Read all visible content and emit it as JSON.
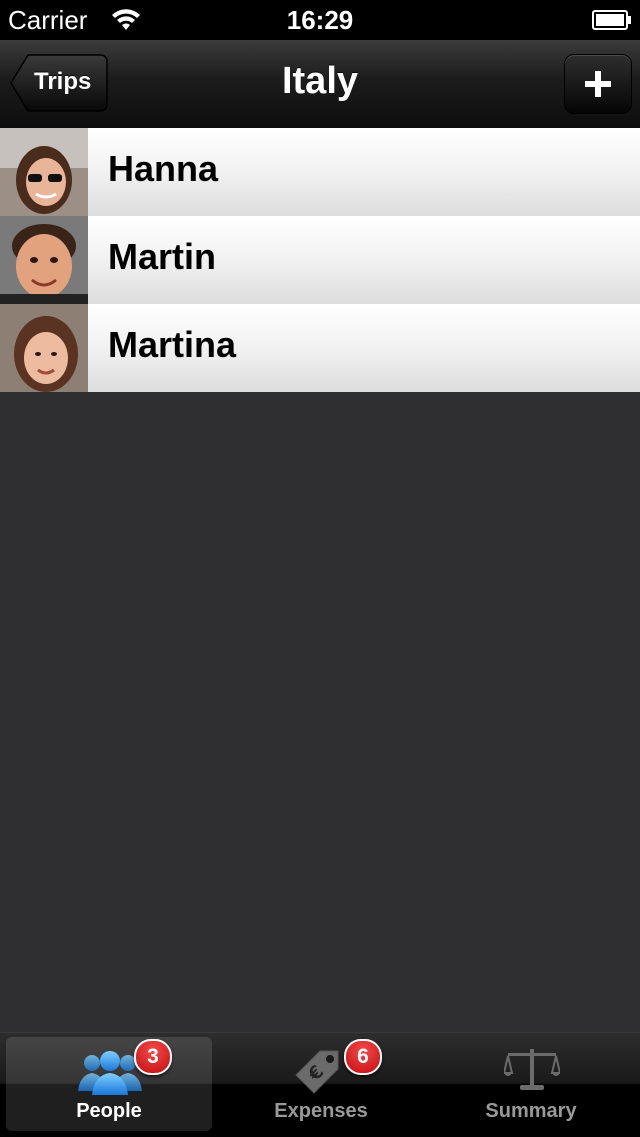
{
  "status_bar": {
    "carrier": "Carrier",
    "time": "16:29",
    "wifi_icon": "wifi-icon",
    "battery_icon": "battery-icon"
  },
  "nav_bar": {
    "title": "Italy",
    "back_label": "Trips",
    "add_icon": "plus-icon"
  },
  "people": [
    {
      "name": "Hanna"
    },
    {
      "name": "Martin"
    },
    {
      "name": "Martina"
    }
  ],
  "tabs": [
    {
      "label": "People",
      "badge": "3",
      "icon": "people-icon",
      "selected": true
    },
    {
      "label": "Expenses",
      "badge": "6",
      "icon": "price-tag-euro-icon",
      "selected": false
    },
    {
      "label": "Summary",
      "badge": "",
      "icon": "scales-icon",
      "selected": false
    }
  ],
  "colors": {
    "badge": "#d1151a",
    "selected_tab_icon": "#2e9cf0",
    "background": "#2f2f31"
  }
}
